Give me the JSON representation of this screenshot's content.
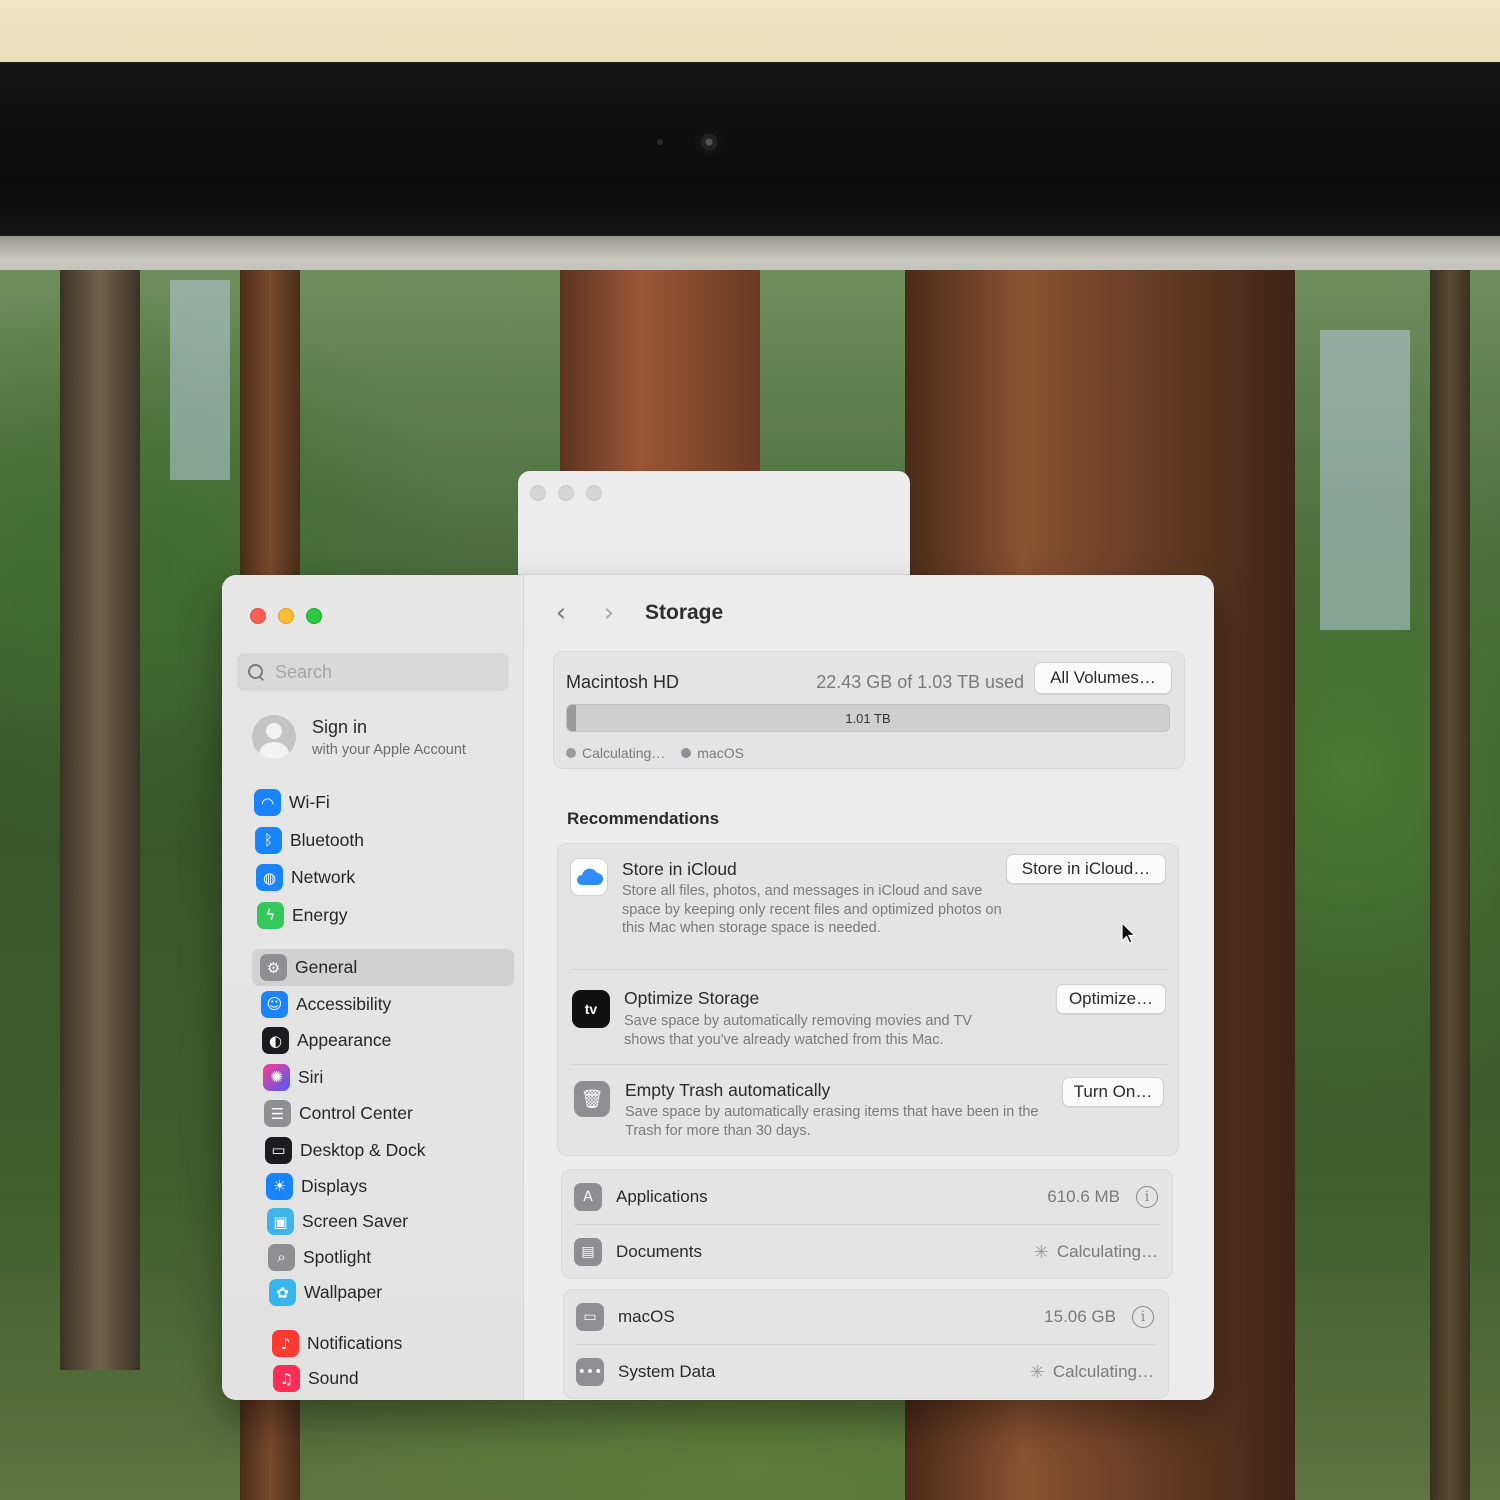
{
  "sidebar": {
    "search_placeholder": "Search",
    "account": {
      "title": "Sign in",
      "subtitle": "with your Apple Account"
    },
    "group1": [
      {
        "label": "Wi-Fi",
        "icon": "wifi-icon",
        "color": "#1a84ff"
      },
      {
        "label": "Bluetooth",
        "icon": "bluetooth-icon",
        "color": "#1a84ff"
      },
      {
        "label": "Network",
        "icon": "globe-icon",
        "color": "#1a84ff"
      },
      {
        "label": "Energy",
        "icon": "bolt-icon",
        "color": "#34c759"
      }
    ],
    "group2": [
      {
        "label": "General",
        "icon": "gear-icon",
        "color": "#8e8e93",
        "active": true
      },
      {
        "label": "Accessibility",
        "icon": "accessibility-icon",
        "color": "#1a84ff"
      },
      {
        "label": "Appearance",
        "icon": "appearance-icon",
        "color": "#1c1c1e"
      },
      {
        "label": "Siri",
        "icon": "siri-icon",
        "color": "#b63ad6"
      },
      {
        "label": "Control Center",
        "icon": "control-center-icon",
        "color": "#8e8e93"
      },
      {
        "label": "Desktop & Dock",
        "icon": "dock-icon",
        "color": "#1c1c1e"
      },
      {
        "label": "Displays",
        "icon": "sun-icon",
        "color": "#1a84ff"
      },
      {
        "label": "Screen Saver",
        "icon": "screen-saver-icon",
        "color": "#3fb4e8"
      },
      {
        "label": "Spotlight",
        "icon": "magnifier-icon",
        "color": "#8e8e93"
      },
      {
        "label": "Wallpaper",
        "icon": "flower-icon",
        "color": "#36b5f0"
      }
    ],
    "group3": [
      {
        "label": "Notifications",
        "icon": "bell-icon",
        "color": "#ff3b30"
      },
      {
        "label": "Sound",
        "icon": "speaker-icon",
        "color": "#ff2d55"
      }
    ]
  },
  "header": {
    "title": "Storage",
    "back": "‹",
    "forward": "›"
  },
  "disk": {
    "name": "Macintosh HD",
    "usage": "22.43 GB of 1.03 TB used",
    "all_volumes_button": "All Volumes…",
    "bar_label": "1.01 TB",
    "macos_fraction": 0.015,
    "legend": [
      {
        "label": "Calculating…",
        "color": "#9a9a9a"
      },
      {
        "label": "macOS",
        "color": "#8e8e93"
      }
    ]
  },
  "recommendations": {
    "title": "Recommendations",
    "items": [
      {
        "title": "Store in iCloud",
        "desc": "Store all files, photos, and messages in iCloud and save space by keeping only recent files and optimized photos on this Mac when storage space is needed.",
        "button": "Store in iCloud…",
        "icon": "icloud-icon"
      },
      {
        "title": "Optimize Storage",
        "desc": "Save space by automatically removing movies and TV shows that you've already watched from this Mac.",
        "button": "Optimize…",
        "icon": "apple-tv-icon"
      },
      {
        "title": "Empty Trash automatically",
        "desc": "Save space by automatically erasing items that have been in the Trash for more than 30 days.",
        "button": "Turn On…",
        "icon": "trash-icon"
      }
    ]
  },
  "categories": {
    "group1": [
      {
        "label": "Applications",
        "size": "610.6 MB",
        "icon": "app-store-icon"
      },
      {
        "label": "Documents",
        "size": "Calculating…",
        "icon": "document-icon"
      }
    ],
    "group2": [
      {
        "label": "macOS",
        "size": "15.06 GB",
        "icon": "display-icon"
      },
      {
        "label": "System Data",
        "size": "Calculating…",
        "icon": "ellipsis-icon"
      }
    ]
  },
  "appletv_badge": "tv"
}
